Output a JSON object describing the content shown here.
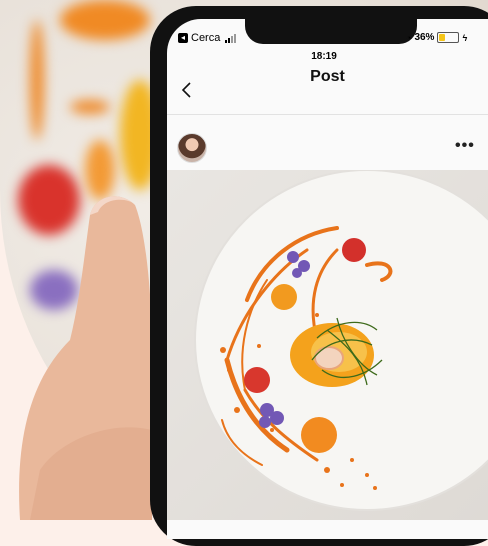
{
  "status_bar": {
    "carrier": "Cerca",
    "time": "18:19",
    "battery_percent": "36%",
    "battery_level": 0.36
  },
  "nav": {
    "title": "Post",
    "back_icon": "chevron-left-icon"
  },
  "post_header": {
    "more_label": "•••"
  },
  "colors": {
    "page_background": "#fdf0ea",
    "sauce": "#e8731a",
    "plate": "#f7f6f3",
    "battery": "#f5c518"
  }
}
